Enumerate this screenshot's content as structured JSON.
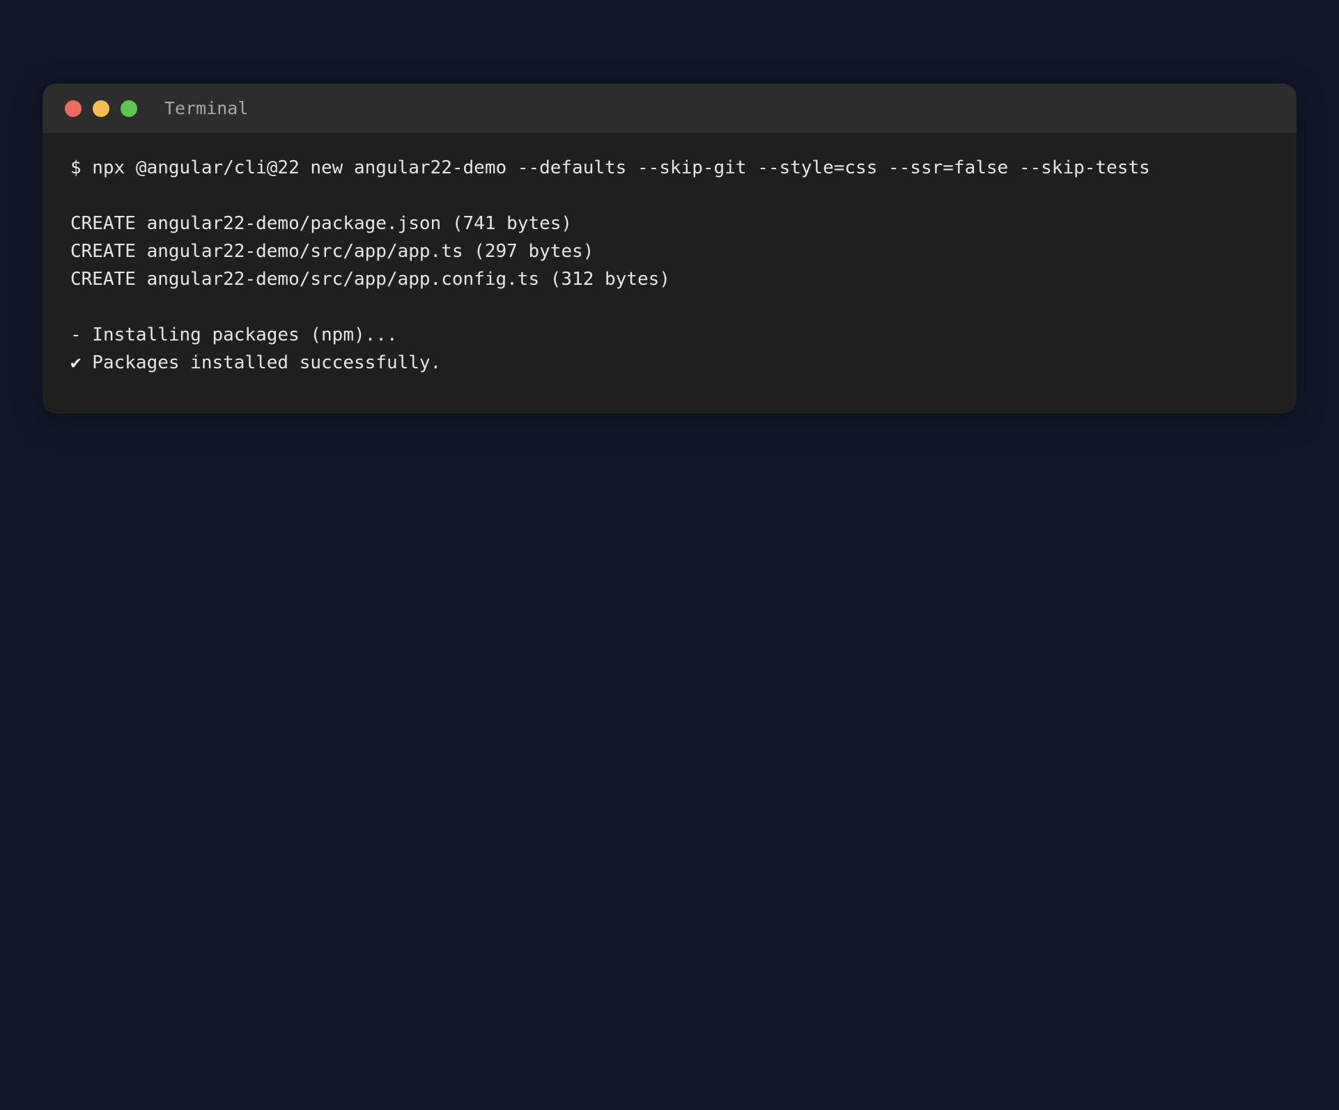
{
  "window": {
    "title": "Terminal",
    "traffic_lights": {
      "close_color": "#ed6a5e",
      "minimize_color": "#f5bf4f",
      "zoom_color": "#61c554"
    }
  },
  "terminal": {
    "command_line": "$ npx @angular/cli@22 new angular22-demo --defaults --skip-git --style=css --ssr=false --skip-tests",
    "create_lines": [
      "CREATE angular22-demo/package.json (741 bytes)",
      "CREATE angular22-demo/src/app/app.ts (297 bytes)",
      "CREATE angular22-demo/src/app/app.config.ts (312 bytes)"
    ],
    "status_lines": [
      "- Installing packages (npm)...",
      "✔ Packages installed successfully."
    ]
  },
  "colors": {
    "page_background": "#111729",
    "window_background": "#1f1f1f",
    "title_bar_background": "#2d2d2d",
    "text": "#e6e6e6",
    "title_text": "#a8a8a8"
  }
}
